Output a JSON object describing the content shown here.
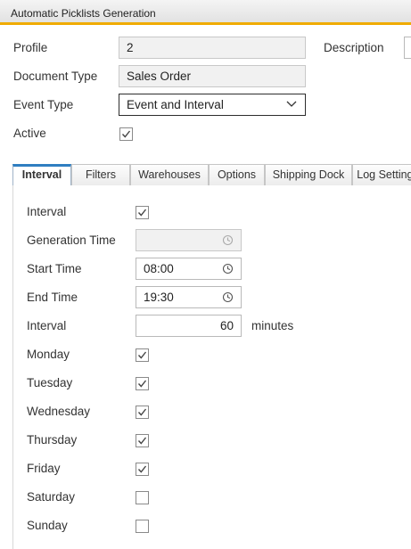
{
  "window": {
    "title": "Automatic Picklists Generation"
  },
  "header": {
    "profile_label": "Profile",
    "profile_value": "2",
    "description_label": "Description",
    "document_type_label": "Document Type",
    "document_type_value": "Sales Order",
    "event_type_label": "Event Type",
    "event_type_value": "Event and Interval",
    "active_label": "Active",
    "active_checked": true
  },
  "tabs": [
    {
      "label": "Interval",
      "active": true
    },
    {
      "label": "Filters",
      "active": false
    },
    {
      "label": "Warehouses",
      "active": false
    },
    {
      "label": "Options",
      "active": false
    },
    {
      "label": "Shipping Dock",
      "active": false
    },
    {
      "label": "Log Settings",
      "active": false
    }
  ],
  "interval_tab": {
    "interval_label": "Interval",
    "interval_checked": true,
    "generation_time_label": "Generation Time",
    "generation_time_value": "",
    "start_time_label": "Start Time",
    "start_time_value": "08:00",
    "end_time_label": "End Time",
    "end_time_value": "19:30",
    "interval_minutes_label": "Interval",
    "interval_minutes_value": "60",
    "minutes_unit": "minutes",
    "days": [
      {
        "label": "Monday",
        "checked": true
      },
      {
        "label": "Tuesday",
        "checked": true
      },
      {
        "label": "Wednesday",
        "checked": true
      },
      {
        "label": "Thursday",
        "checked": true
      },
      {
        "label": "Friday",
        "checked": true
      },
      {
        "label": "Saturday",
        "checked": false
      },
      {
        "label": "Sunday",
        "checked": false
      }
    ]
  },
  "icons": {
    "dropdown": "chevron-down-icon",
    "time_picker": "clock-icon",
    "check": "checkmark-icon"
  },
  "colors": {
    "accent_bar": "#f0ab00",
    "active_tab": "#2f7ec1",
    "readonly_bg": "#f1f1f1"
  }
}
